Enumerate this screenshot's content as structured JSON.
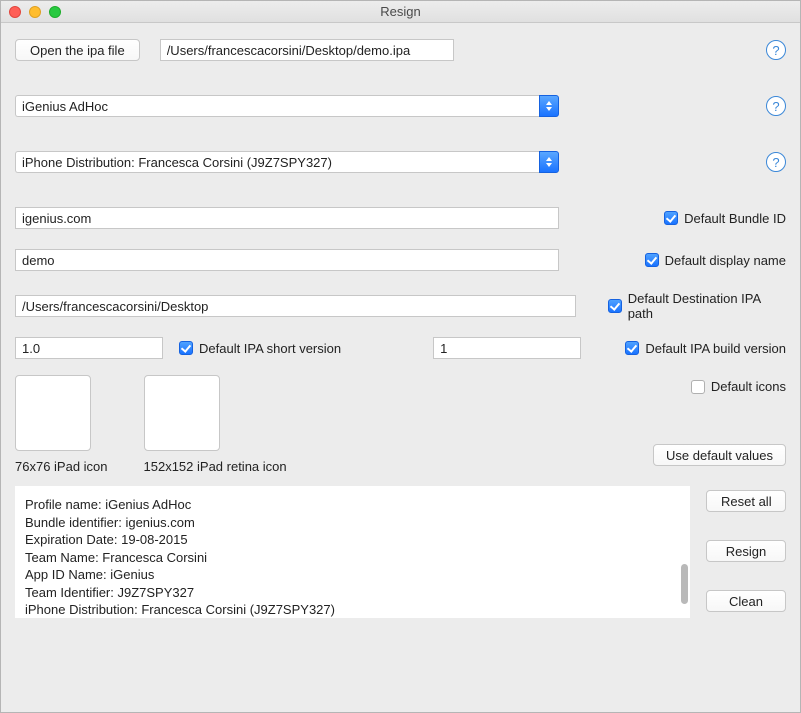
{
  "window": {
    "title": "Resign"
  },
  "open": {
    "button": "Open the ipa file",
    "path": "/Users/francescacorsini/Desktop/demo.ipa"
  },
  "profile": {
    "selected": "iGenius AdHoc"
  },
  "cert": {
    "selected": "iPhone Distribution: Francesca Corsini (J9Z7SPY327)"
  },
  "bundle": {
    "value": "igenius.com",
    "default_label": "Default Bundle ID"
  },
  "display": {
    "value": "demo",
    "default_label": "Default display name"
  },
  "dest": {
    "value": "/Users/francescacorsini/Desktop",
    "default_label": "Default Destination IPA path"
  },
  "short_version": {
    "value": "1.0",
    "default_label": "Default IPA short version"
  },
  "build_version": {
    "value": "1",
    "default_label": "Default IPA build version"
  },
  "icons": {
    "default_label": "Default icons",
    "ipad_label": "76x76 iPad icon",
    "ipad_retina_label": "152x152 iPad retina icon"
  },
  "use_default_btn": "Use default values",
  "info_lines": {
    "l1": "Profile name: iGenius AdHoc",
    "l2": "Bundle identifier: igenius.com",
    "l3": "Expiration Date: 19-08-2015",
    "l4": "Team Name: Francesca Corsini",
    "l5": "App ID Name: iGenius",
    "l6": "Team Identifier: J9Z7SPY327",
    "l7": "",
    "l8": "iPhone Distribution: Francesca Corsini (J9Z7SPY327)"
  },
  "actions": {
    "reset": "Reset all",
    "resign": "Resign",
    "clean": "Clean"
  }
}
